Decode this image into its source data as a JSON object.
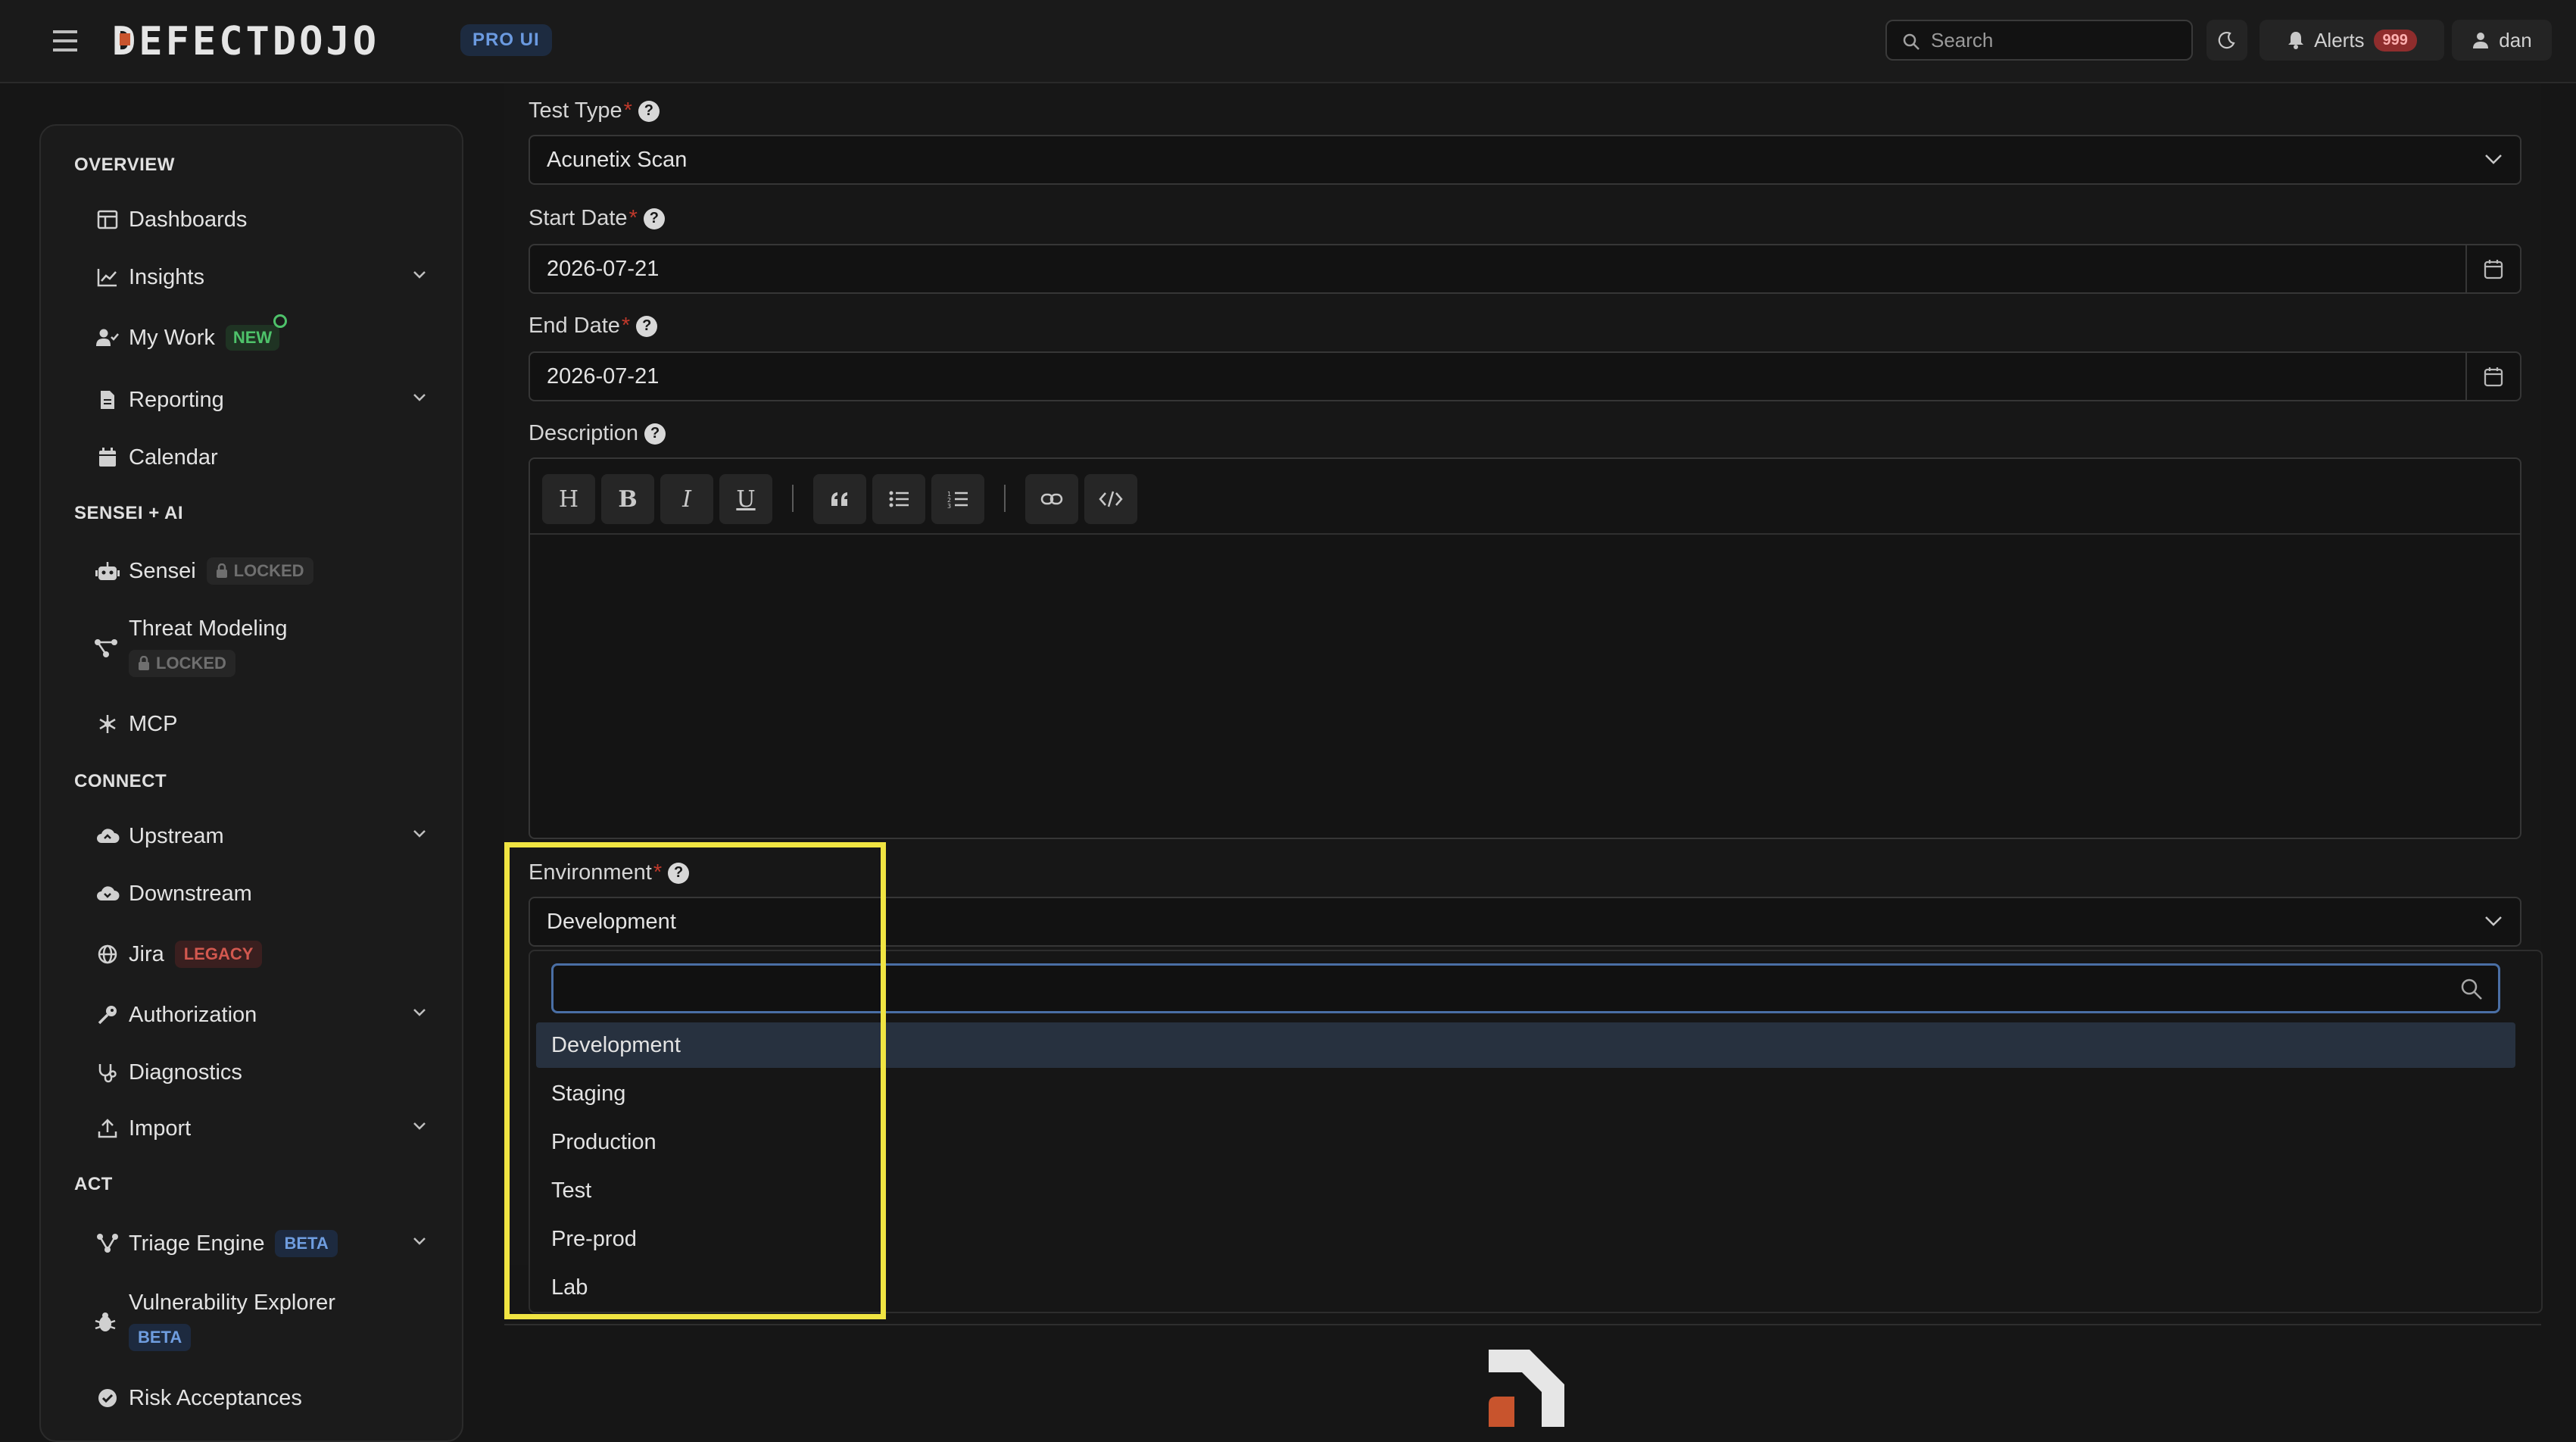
{
  "app": {
    "brand": "DEFECTDOJO",
    "badge": "PRO UI"
  },
  "topbar": {
    "search_placeholder": "Search",
    "alerts_label": "Alerts",
    "alerts_count": "999",
    "user_name": "dan",
    "icons": [
      "menu-icon",
      "search-icon",
      "moon-icon",
      "bell-icon",
      "user-icon"
    ]
  },
  "sidebar": {
    "overview": {
      "heading": "OVERVIEW",
      "items": [
        {
          "label": "Dashboards",
          "icon": "dashboard-icon"
        },
        {
          "label": "Insights",
          "icon": "chart-icon",
          "expandable": true
        },
        {
          "label": "My Work",
          "icon": "user-check-icon",
          "tag": "NEW"
        },
        {
          "label": "Reporting",
          "icon": "document-icon",
          "expandable": true
        },
        {
          "label": "Calendar",
          "icon": "calendar-icon"
        }
      ]
    },
    "sensei": {
      "heading": "SENSEI + AI",
      "items": [
        {
          "label": "Sensei",
          "icon": "robot-icon",
          "tag": "LOCKED"
        },
        {
          "label": "Threat Modeling",
          "icon": "network-icon",
          "tag": "LOCKED"
        },
        {
          "label": "MCP",
          "icon": "mcp-icon"
        }
      ]
    },
    "connect": {
      "heading": "CONNECT",
      "items": [
        {
          "label": "Upstream",
          "icon": "cloud-upload-icon",
          "expandable": true
        },
        {
          "label": "Downstream",
          "icon": "cloud-download-icon"
        },
        {
          "label": "Jira",
          "icon": "globe-icon",
          "tag": "LEGACY"
        },
        {
          "label": "Authorization",
          "icon": "key-icon",
          "expandable": true
        },
        {
          "label": "Diagnostics",
          "icon": "stethoscope-icon"
        },
        {
          "label": "Import",
          "icon": "upload-icon",
          "expandable": true
        }
      ]
    },
    "act": {
      "heading": "ACT",
      "items": [
        {
          "label": "Triage Engine",
          "icon": "triage-icon",
          "tag": "BETA",
          "expandable": true
        },
        {
          "label": "Vulnerability Explorer",
          "icon": "bug-icon",
          "tag": "BETA"
        },
        {
          "label": "Risk Acceptances",
          "icon": "check-circle-icon"
        }
      ]
    }
  },
  "form": {
    "test_type": {
      "label": "Test Type",
      "value": "Acunetix Scan"
    },
    "start_date": {
      "label": "Start Date",
      "value": "2026-07-21"
    },
    "end_date": {
      "label": "End Date",
      "value": "2026-07-21"
    },
    "description": {
      "label": "Description",
      "toolbar": [
        "H",
        "B",
        "I",
        "U"
      ]
    },
    "environment": {
      "label": "Environment",
      "value": "Development",
      "options": [
        "Development",
        "Staging",
        "Production",
        "Test",
        "Pre-prod",
        "Lab"
      ]
    },
    "required_mark": "*",
    "help_glyph": "?"
  },
  "colors": {
    "accent_blue": "#4a6fa5",
    "required_red": "#c0392b",
    "highlight_yellow": "#f0e442",
    "alert_red": "#8f2d2d"
  }
}
